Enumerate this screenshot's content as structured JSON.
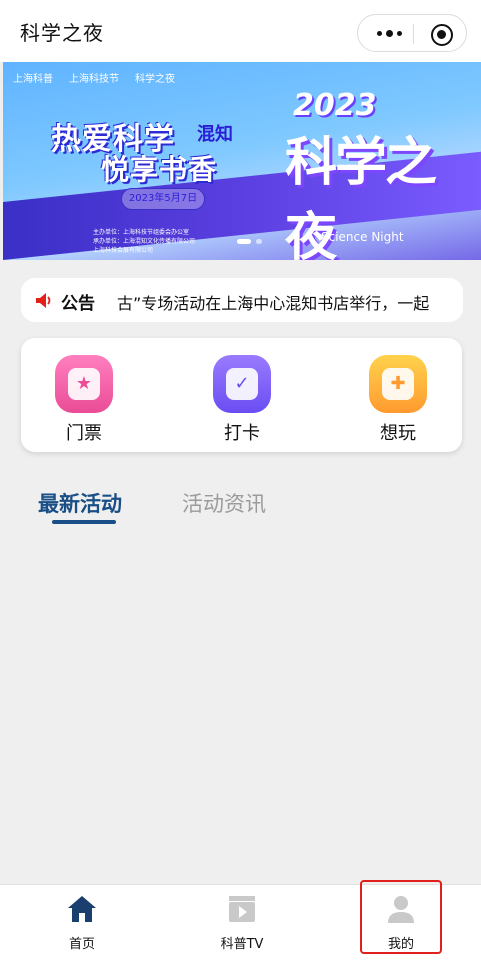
{
  "header": {
    "title": "科学之夜"
  },
  "banner": {
    "logos": [
      "上海科普",
      "上海科技节",
      "科学之夜"
    ],
    "headline1": "热爱科学",
    "brand": "混知",
    "headline2": "悦享书香",
    "date": "2023年5月7日",
    "organizers": [
      "主办单位：上海科技节组委会办公室",
      "承办单位：上海混知文化传播有限公司",
      "上海科技会展有限公司"
    ],
    "year": "2023",
    "title": "科学之夜",
    "subtitle": "Science Night"
  },
  "notice": {
    "label": "公告",
    "text": "古”专场活动在上海中心混知书店举行，一起"
  },
  "features": [
    {
      "label": "门票",
      "icon": "ticket-icon"
    },
    {
      "label": "打卡",
      "icon": "checkin-icon"
    },
    {
      "label": "想玩",
      "icon": "gamepad-icon"
    }
  ],
  "tabs": [
    {
      "label": "最新活动",
      "active": true
    },
    {
      "label": "活动资讯",
      "active": false
    }
  ],
  "bottom_nav": [
    {
      "label": "首页",
      "icon": "home-icon"
    },
    {
      "label": "科普TV",
      "icon": "video-icon"
    },
    {
      "label": "我的",
      "icon": "user-icon"
    }
  ],
  "colors": {
    "accent": "#1a4e86",
    "highlight": "#e0211b"
  }
}
